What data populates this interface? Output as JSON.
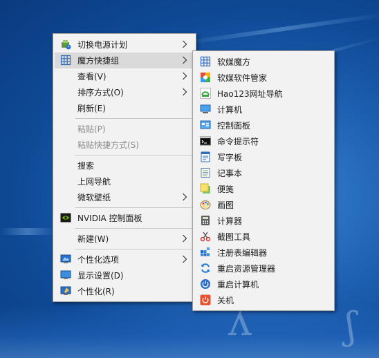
{
  "context_menu": {
    "items": [
      {
        "label": "切换电源计划",
        "icon": "power-plan-icon",
        "submenu": true
      },
      {
        "label": "魔方快捷组",
        "icon": "grid-icon",
        "submenu": true,
        "highlighted": true
      },
      {
        "label": "查看(V)",
        "submenu": true
      },
      {
        "label": "排序方式(O)",
        "submenu": true
      },
      {
        "label": "刷新(E)"
      },
      {
        "label": "粘贴(P)",
        "disabled": true
      },
      {
        "label": "粘贴快捷方式(S)",
        "disabled": true
      },
      {
        "label": "搜索"
      },
      {
        "label": "上网导航"
      },
      {
        "label": "微软壁纸",
        "submenu": true
      },
      {
        "label": "NVIDIA 控制面板",
        "icon": "nvidia-icon"
      },
      {
        "label": "新建(W)",
        "submenu": true
      },
      {
        "label": "个性化选项",
        "icon": "personalize-options-icon",
        "submenu": true
      },
      {
        "label": "显示设置(D)",
        "icon": "display-icon"
      },
      {
        "label": "个性化(R)",
        "icon": "personalize-icon"
      }
    ]
  },
  "submenu": {
    "items": [
      {
        "label": "软媒魔方",
        "icon": "grid-icon"
      },
      {
        "label": "软媒软件管家",
        "icon": "software-manager-icon"
      },
      {
        "label": "Hao123网址导航",
        "icon": "hao123-icon"
      },
      {
        "label": "计算机",
        "icon": "computer-icon"
      },
      {
        "label": "控制面板",
        "icon": "control-panel-icon"
      },
      {
        "label": "命令提示符",
        "icon": "command-prompt-icon"
      },
      {
        "label": "写字板",
        "icon": "wordpad-icon"
      },
      {
        "label": "记事本",
        "icon": "notepad-icon"
      },
      {
        "label": "便笺",
        "icon": "sticky-notes-icon"
      },
      {
        "label": "画图",
        "icon": "paint-icon"
      },
      {
        "label": "计算器",
        "icon": "calculator-icon"
      },
      {
        "label": "截图工具",
        "icon": "snipping-tool-icon"
      },
      {
        "label": "注册表编辑器",
        "icon": "registry-editor-icon"
      },
      {
        "label": "重启资源管理器",
        "icon": "restart-explorer-icon"
      },
      {
        "label": "重启计算机",
        "icon": "restart-computer-icon"
      },
      {
        "label": "关机",
        "icon": "shutdown-icon"
      }
    ]
  },
  "colors": {
    "menu_background": "#f2f2f2",
    "highlight": "#dadada",
    "disabled_text": "#8c8c8c",
    "desktop_blue": "#1f63b4"
  }
}
